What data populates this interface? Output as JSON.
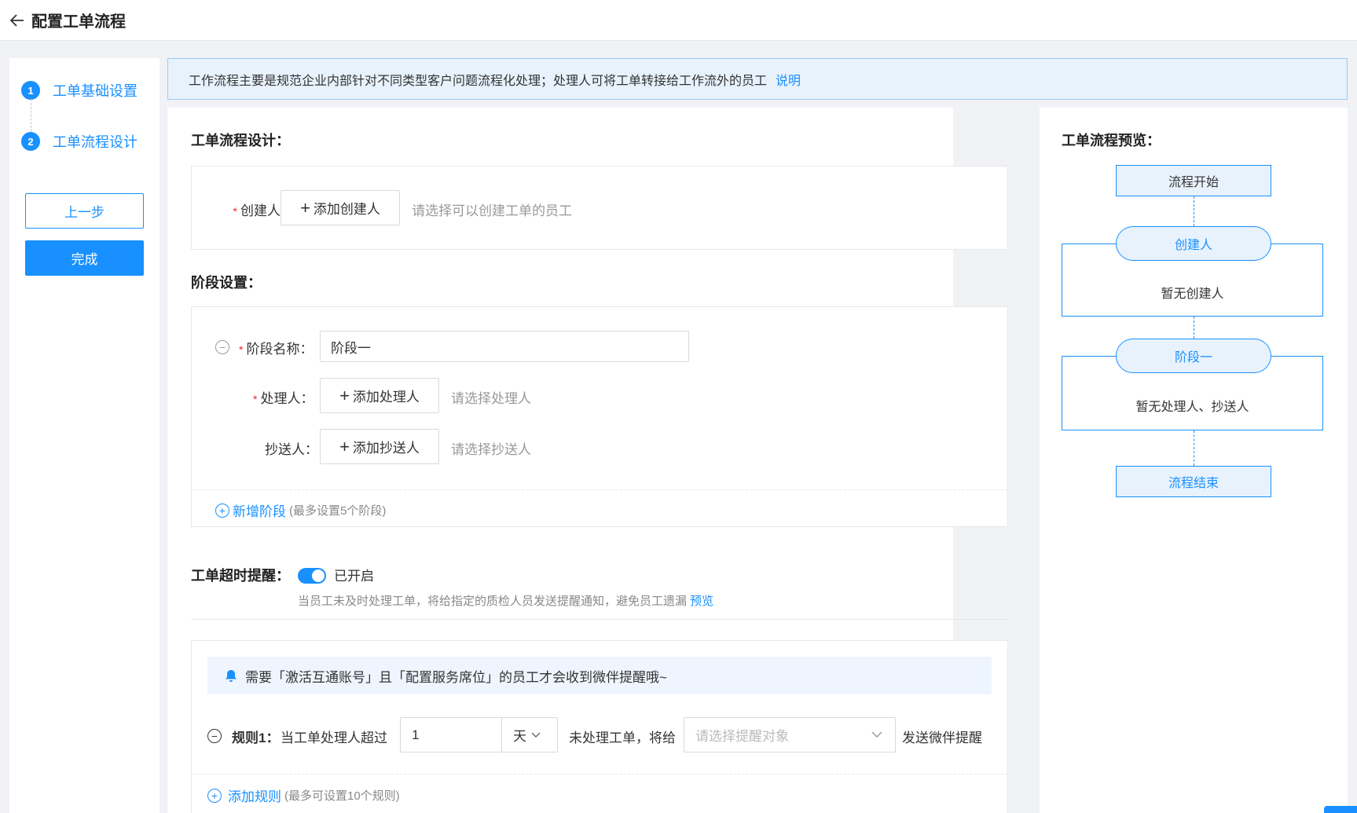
{
  "header": {
    "title": "配置工单流程"
  },
  "steps": [
    {
      "num": "1",
      "label": "工单基础设置"
    },
    {
      "num": "2",
      "label": "工单流程设计"
    }
  ],
  "buttons": {
    "prev": "上一步",
    "finish": "完成"
  },
  "notice": {
    "text": "工作流程主要是规范企业内部针对不同类型客户问题流程化处理；处理人可将工单转接给工作流外的员工",
    "link": "说明"
  },
  "design": {
    "title": "工单流程设计：",
    "creator_label": "创建人：",
    "creator_btn": "添加创建人",
    "creator_hint": "请选择可以创建工单的员工"
  },
  "stage": {
    "title": "阶段设置：",
    "name_label": "阶段名称：",
    "name_value": "阶段一",
    "handler_label": "处理人：",
    "handler_btn": "添加处理人",
    "handler_hint": "请选择处理人",
    "cc_label": "抄送人：",
    "cc_btn": "添加抄送人",
    "cc_hint": "请选择抄送人",
    "add_stage": "新增阶段",
    "add_stage_note": "(最多设置5个阶段)"
  },
  "timeout": {
    "title": "工单超时提醒：",
    "toggle_on": true,
    "status": "已开启",
    "desc": "当员工未及时处理工单，将给指定的质检人员发送提醒通知，避免员工遗漏",
    "preview_link": "预览",
    "bell_text": "需要「激活互通账号」且「配置服务席位」的员工才会收到微伴提醒哦~",
    "rule_label": "规则1：",
    "rule_text1": "当工单处理人超过",
    "rule_value": "1",
    "rule_unit": "天",
    "rule_text2": "未处理工单，将给",
    "rule_target_placeholder": "请选择提醒对象",
    "rule_text3": "发送微伴提醒",
    "add_rule": "添加规则",
    "add_rule_note": "(最多可设置10个规则)"
  },
  "preview": {
    "title": "工单流程预览：",
    "start": "流程开始",
    "creator_pill": "创建人",
    "creator_text": "暂无创建人",
    "stage_pill": "阶段一",
    "stage_text": "暂无处理人、抄送人",
    "end": "流程结束"
  },
  "colors": {
    "primary": "#1890ff",
    "required": "#f5222d",
    "notice_bg": "#e8f2fd"
  }
}
